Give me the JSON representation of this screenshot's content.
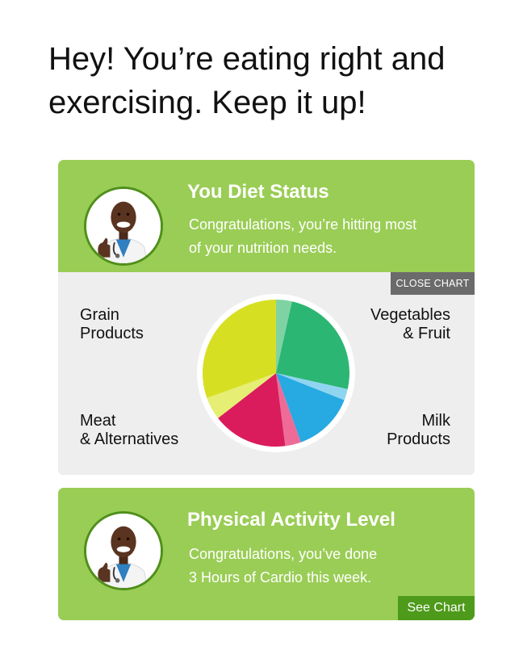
{
  "headline": {
    "line1": "Hey! You’re eating right and",
    "line2": "exercising. Keep it up!"
  },
  "diet_card": {
    "avatar_icon": "doctor-thumbs-up-avatar",
    "title": "You Diet Status",
    "text_line1": "Congratulations, you’re hitting most",
    "text_line2": "of your nutrition needs.",
    "close_chart_label": "CLOSE CHART"
  },
  "activity_card": {
    "avatar_icon": "doctor-thumbs-up-avatar",
    "title": "Physical Activity Level",
    "text_line1": "Congratulations, you’ve done",
    "text_line2": "3 Hours of Cardio this week.",
    "see_chart_label": "See Chart"
  },
  "colors": {
    "card_green": "#9acd55",
    "avatar_ring": "#4f8f1b",
    "panel_gray": "#eeeeee",
    "close_button": "#6b6b6b",
    "see_chart_button": "#4e9a1a"
  },
  "chart_data": {
    "type": "pie",
    "labels": {
      "grain_line1": "Grain",
      "grain_line2": "Products",
      "veg_line1": "Vegetables",
      "veg_line2": "& Fruit",
      "meat_line1": "Meat",
      "meat_line2": "& Alternatives",
      "milk_line1": "Milk",
      "milk_line2": "Products"
    },
    "slices": [
      {
        "category": "Vegetables & Fruit",
        "part": "remaining",
        "value": 3.5,
        "color": "#7fd3a3"
      },
      {
        "category": "Vegetables & Fruit",
        "part": "consumed",
        "value": 25,
        "color": "#2bb673"
      },
      {
        "category": "Milk Products",
        "part": "remaining",
        "value": 2.5,
        "color": "#8fd5f0"
      },
      {
        "category": "Milk Products",
        "part": "consumed",
        "value": 13.5,
        "color": "#27a9e1"
      },
      {
        "category": "Meat & Alternatives",
        "part": "remaining",
        "value": 3.5,
        "color": "#ee6b98"
      },
      {
        "category": "Meat & Alternatives",
        "part": "consumed",
        "value": 16.5,
        "color": "#da1c5c"
      },
      {
        "category": "Grain Products",
        "part": "remaining",
        "value": 5,
        "color": "#e6ee74"
      },
      {
        "category": "Grain Products",
        "part": "consumed",
        "value": 30.5,
        "color": "#d7df23"
      }
    ]
  }
}
